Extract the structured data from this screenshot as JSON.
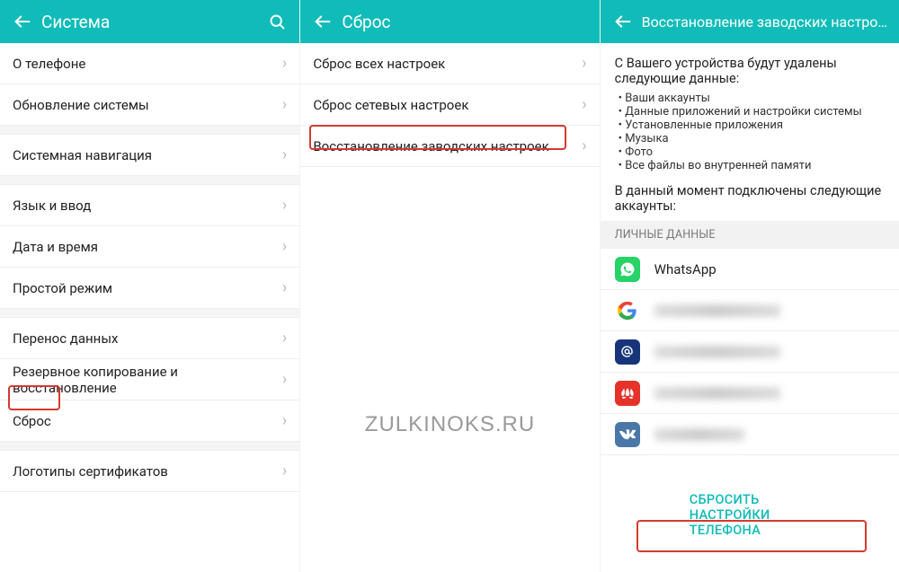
{
  "pane1": {
    "title": "Система",
    "items": [
      {
        "label": "О телефоне"
      },
      {
        "label": "Обновление системы"
      },
      {
        "label": "Системная навигация"
      },
      {
        "label": "Язык и ввод"
      },
      {
        "label": "Дата и время"
      },
      {
        "label": "Простой режим"
      },
      {
        "label": "Перенос данных"
      },
      {
        "label": "Резервное копирование и восстановление"
      },
      {
        "label": "Сброс"
      },
      {
        "label": "Логотипы сертификатов"
      }
    ]
  },
  "pane2": {
    "title": "Сброс",
    "items": [
      {
        "label": "Сброс всех настроек"
      },
      {
        "label": "Сброс сетевых настроек"
      },
      {
        "label": "Восстановление заводских настроек"
      }
    ],
    "watermark": "ZULKINOKS.RU"
  },
  "pane3": {
    "title": "Восстановление заводских настроек",
    "lead": "С Вашего устройства будут удалены следующие данные:",
    "bullets": [
      "Ваши аккаунты",
      "Данные приложений и настройки системы",
      "Установленные приложения",
      "Музыка",
      "Фото",
      "Все файлы во внутренней памяти"
    ],
    "sub": "В данный момент подключены следующие аккаунты:",
    "section": "ЛИЧНЫЕ ДАННЫЕ",
    "accounts": [
      {
        "name": "WhatsApp",
        "icon": "whatsapp"
      },
      {
        "name": "",
        "icon": "google"
      },
      {
        "name": "",
        "icon": "at"
      },
      {
        "name": "",
        "icon": "huawei"
      },
      {
        "name": "",
        "icon": "vk"
      }
    ],
    "reset_button": "СБРОСИТЬ НАСТРОЙКИ ТЕЛЕФОНА"
  }
}
